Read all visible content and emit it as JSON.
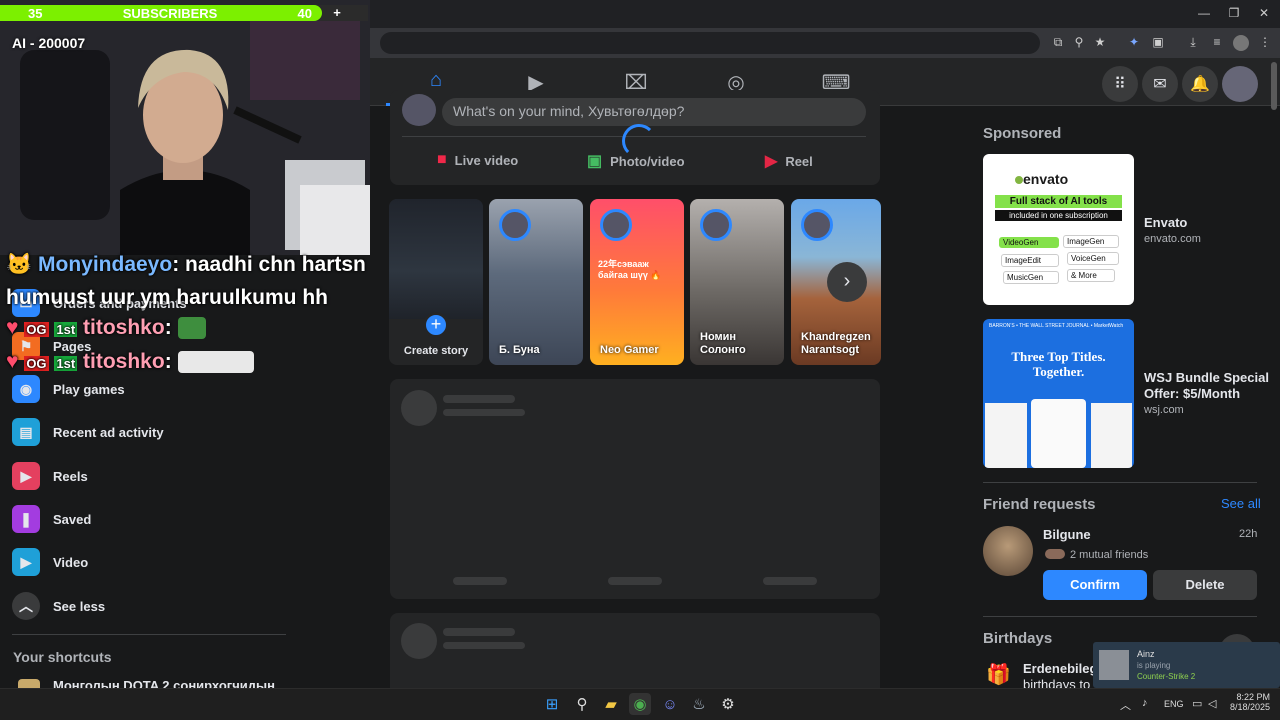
{
  "stream": {
    "sub_left": "35",
    "sub_label": "SUBSCRIBERS",
    "sub_right": "40",
    "ai_tag": "AI - 200007",
    "chat": [
      {
        "user": "Monyindaeyo",
        "sep": ":",
        "msg": "naadhi chn hartsn humuust uur ym haruulkumu hh"
      },
      {
        "user": "titoshko",
        "sep": ":",
        "msg": ""
      },
      {
        "user": "titoshko",
        "sep": ":",
        "msg": ""
      }
    ]
  },
  "left_menu": {
    "items": [
      {
        "label": "Orders and payments",
        "icon": "card-icon"
      },
      {
        "label": "Pages",
        "icon": "flag-icon"
      },
      {
        "label": "Play games",
        "icon": "gamepad-icon"
      },
      {
        "label": "Recent ad activity",
        "icon": "ad-icon"
      },
      {
        "label": "Reels",
        "icon": "reels-icon"
      },
      {
        "label": "Saved",
        "icon": "bookmark-icon"
      },
      {
        "label": "Video",
        "icon": "video-icon"
      },
      {
        "label": "See less",
        "icon": "chevron-up-icon"
      }
    ],
    "shortcuts_title": "Your shortcuts",
    "shortcut_item": "Монголын DOTA 2 сонирхогчидын"
  },
  "composer": {
    "placeholder": "What's on your mind, Хувьтөгөлдөр?",
    "live": "Live video",
    "photo": "Photo/video",
    "reel": "Reel"
  },
  "stories": [
    {
      "name": "Create story"
    },
    {
      "name": "Б. Буна"
    },
    {
      "name": "Neo Gamer"
    },
    {
      "name": "Номин Солонго"
    },
    {
      "name": "Khandregzen Narantsogt"
    }
  ],
  "story_overlay_text": "22年сэвааж байгаа шүү 🔥",
  "sponsored": {
    "title": "Sponsored",
    "ads": [
      {
        "name": "Envato",
        "domain": "envato.com",
        "brand": "envato",
        "headline": "Full stack of AI tools",
        "sub": "included in one subscription",
        "tags": [
          "VideoGen",
          "ImageGen",
          "ImageEdit",
          "VoiceGen",
          "MusicGen",
          "& More"
        ]
      },
      {
        "name": "WSJ Bundle Special Offer: $5/Month",
        "domain": "wsj.com",
        "headline": "Three Top Titles. Together.",
        "masthead": "BARRON'S • THE WALL STREET JOURNAL • MarketWatch"
      }
    ]
  },
  "friend_requests": {
    "title": "Friend requests",
    "see_all": "See all",
    "name": "Bilgune",
    "time": "22h",
    "mutual": "2 mutual friends",
    "confirm": "Confirm",
    "delete": "Delete"
  },
  "birthdays": {
    "title": "Birthdays",
    "name": "Erdenebileg",
    "rest": "birthdays to"
  },
  "steam_toast": {
    "user": "Ainz",
    "status": "is playing",
    "game": "Counter-Strike 2"
  },
  "taskbar": {
    "lang": "ENG",
    "time": "8:22 PM",
    "date": "8/18/2025"
  },
  "colors": {
    "accent": "#2d88ff",
    "sub_green": "#7cf000",
    "bg": "#18191a",
    "card": "#242526"
  }
}
